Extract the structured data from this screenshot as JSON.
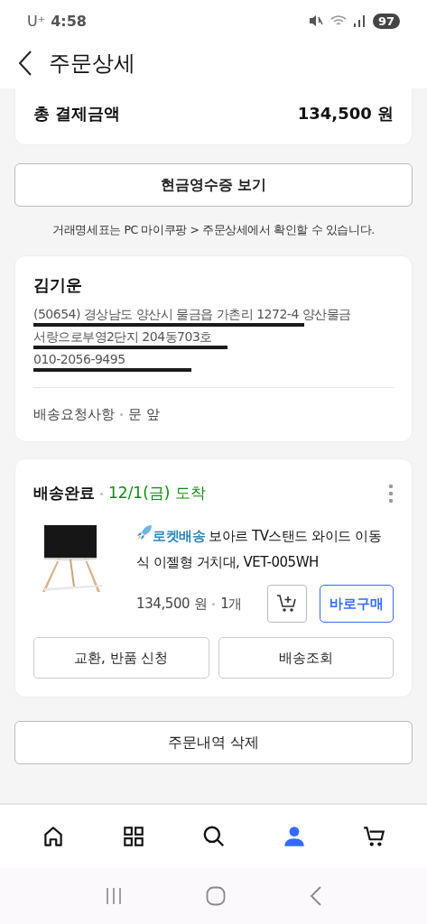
{
  "status_bar": {
    "carrier": "U⁺",
    "time": "4:58",
    "battery": "97"
  },
  "header": {
    "title": "주문상세"
  },
  "total": {
    "label": "총 결제금액",
    "amount": "134,500 원"
  },
  "receipt_button": "현금영수증 보기",
  "receipt_note": "거래명세표는 PC 마이쿠팡 > 주문상세에서 확인할 수 있습니다.",
  "address": {
    "name": "김기운",
    "lines": [
      "(50654) 경상남도 양산시 물금읍 가촌리 1272-4 양산물금",
      "서랑으로부영2단지 204동703호",
      "010-2056-9495"
    ],
    "request_label": "배송요청사항",
    "request_value": "문 앞"
  },
  "shipment": {
    "status": "배송완료",
    "arrival": "12/1(금) 도착",
    "badge": "로켓배송",
    "product": "보아르 TV스탠드 와이드 이동식 이젤형 거치대, VET-005WH",
    "price": "134,500 원",
    "quantity": "1개",
    "buy_button": "바로구매",
    "actions": [
      "교환, 반품 신청",
      "배송조회"
    ]
  },
  "delete_button": "주문내역 삭제",
  "bottom_nav": [
    {
      "kind": "home",
      "selected": false
    },
    {
      "kind": "categories",
      "selected": false
    },
    {
      "kind": "search",
      "selected": false
    },
    {
      "kind": "profile",
      "selected": true
    },
    {
      "kind": "cart",
      "selected": false
    }
  ]
}
